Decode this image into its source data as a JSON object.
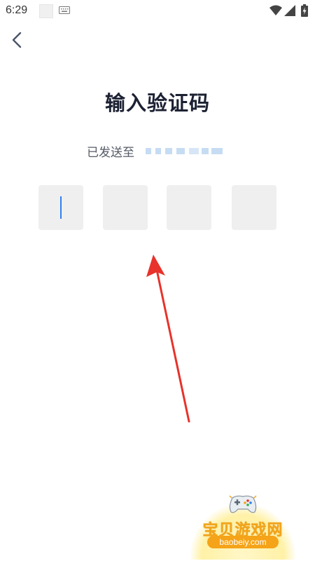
{
  "status_bar": {
    "time": "6:29",
    "icons": [
      "notification-square",
      "keyboard-icon",
      "wifi-icon",
      "signal-icon",
      "battery-icon"
    ]
  },
  "nav": {
    "back_icon": "chevron-left-icon"
  },
  "page": {
    "title": "输入验证码",
    "sent_to_label": "已发送至"
  },
  "code_input": {
    "box_count": 4,
    "active_index": 0,
    "values": [
      "",
      "",
      "",
      ""
    ]
  },
  "annotation": {
    "icon": "red-arrow",
    "color": "#e8322b"
  },
  "watermark": {
    "name": "宝贝游戏网",
    "url": "baobeiy.com"
  },
  "colors": {
    "accent": "#2f7ff0",
    "title": "#1c2133",
    "box": "#efefef"
  }
}
